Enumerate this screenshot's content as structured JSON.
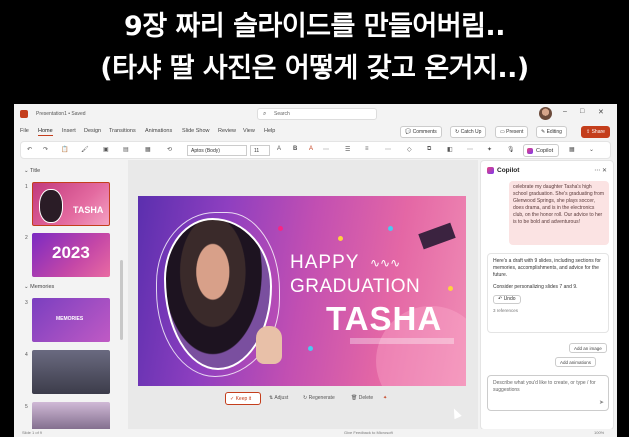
{
  "caption": {
    "line1": "9장 짜리 슬라이드를 만들어버림..",
    "line2": "(타샤 딸 사진은 어떻게 갖고 온거지..)"
  },
  "titlebar": {
    "doc_name": "Presentation1 • Saved",
    "search_placeholder": "Search"
  },
  "menu": {
    "tabs": [
      "File",
      "Home",
      "Insert",
      "Design",
      "Transitions",
      "Animations",
      "Slide Show",
      "Review",
      "View",
      "Help"
    ],
    "comments": "Comments",
    "catchup": "Catch Up",
    "present": "Present",
    "editing": "Editing",
    "share": "Share"
  },
  "ribbon": {
    "font": "Aptos (Body)",
    "size": "11",
    "copilot": "Copilot"
  },
  "slides_pane": {
    "section1": "Title",
    "section2": "Memories",
    "thumb1_text": "TASHA",
    "thumb2_text": "2023",
    "thumb3_text": "MEMORIES",
    "numbers": [
      "1",
      "2",
      "3",
      "4",
      "5"
    ]
  },
  "slide": {
    "happy": "HAPPY",
    "graduation": "GRADUATION",
    "name": "TASHA"
  },
  "design_toolbar": {
    "keep": "Keep it",
    "adjust": "Adjust",
    "regenerate": "Regenerate",
    "delete": "Delete"
  },
  "status": {
    "left": "Slide 1 of 9",
    "feedback": "Give Feedback to Microsoft",
    "zoom": "100%"
  },
  "copilot": {
    "title": "Copilot",
    "user_msg": "celebrate my daughter Tasha's high school graduation. She's graduating from Glenwood Springs, she plays soccer, does drama, and is in the electronics club, on the honor roll. Our advice to her is to be bold and adventurous!",
    "ai_msg": "Here's a draft with 9 slides, including sections for memories, accomplishments, and advice for the future.",
    "ai_msg2": "Consider personalizing slides 7 and 9.",
    "undo": "Undo",
    "refs": "3 references",
    "add_image": "Add an image",
    "add_animation": "Add animations",
    "input_placeholder": "Describe what you'd like to create, or type / for suggestions"
  },
  "colors": {
    "accent": "#c43e1c",
    "slide_purple": "#8e3fc0",
    "slide_pink": "#e467a5"
  }
}
